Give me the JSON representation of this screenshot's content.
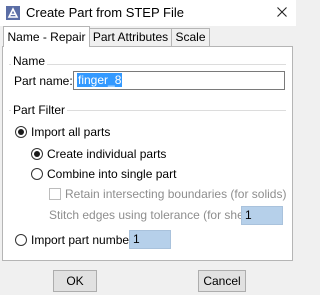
{
  "window": {
    "title": "Create Part from STEP File",
    "app_icon": "abaqus-app-icon",
    "close_icon": "close-icon"
  },
  "tabs": [
    {
      "label": "Name - Repair",
      "active": true
    },
    {
      "label": "Part Attributes",
      "active": false
    },
    {
      "label": "Scale",
      "active": false
    }
  ],
  "name_group": {
    "title": "Name",
    "part_name_label": "Part name:",
    "part_name_value": "finger_8"
  },
  "part_filter": {
    "title": "Part Filter",
    "import_all_parts": {
      "label": "Import all parts",
      "checked": true
    },
    "create_individual_parts": {
      "label": "Create individual parts",
      "checked": true
    },
    "combine_into_single_part": {
      "label": "Combine into single part",
      "checked": false
    },
    "retain_intersecting": {
      "label": "Retain intersecting boundaries (for solids)",
      "checked": false,
      "enabled": false
    },
    "stitch_edges": {
      "label": "Stitch edges using tolerance (for shells)",
      "value": "1",
      "enabled": false
    },
    "import_part_number": {
      "label": "Import part number",
      "checked": false,
      "value": "1"
    }
  },
  "buttons": {
    "ok": "OK",
    "cancel": "Cancel"
  },
  "colors": {
    "selection": "#3399ff",
    "field_highlight": "#b6d0ea",
    "disabled_text": "#8e8e8e"
  }
}
